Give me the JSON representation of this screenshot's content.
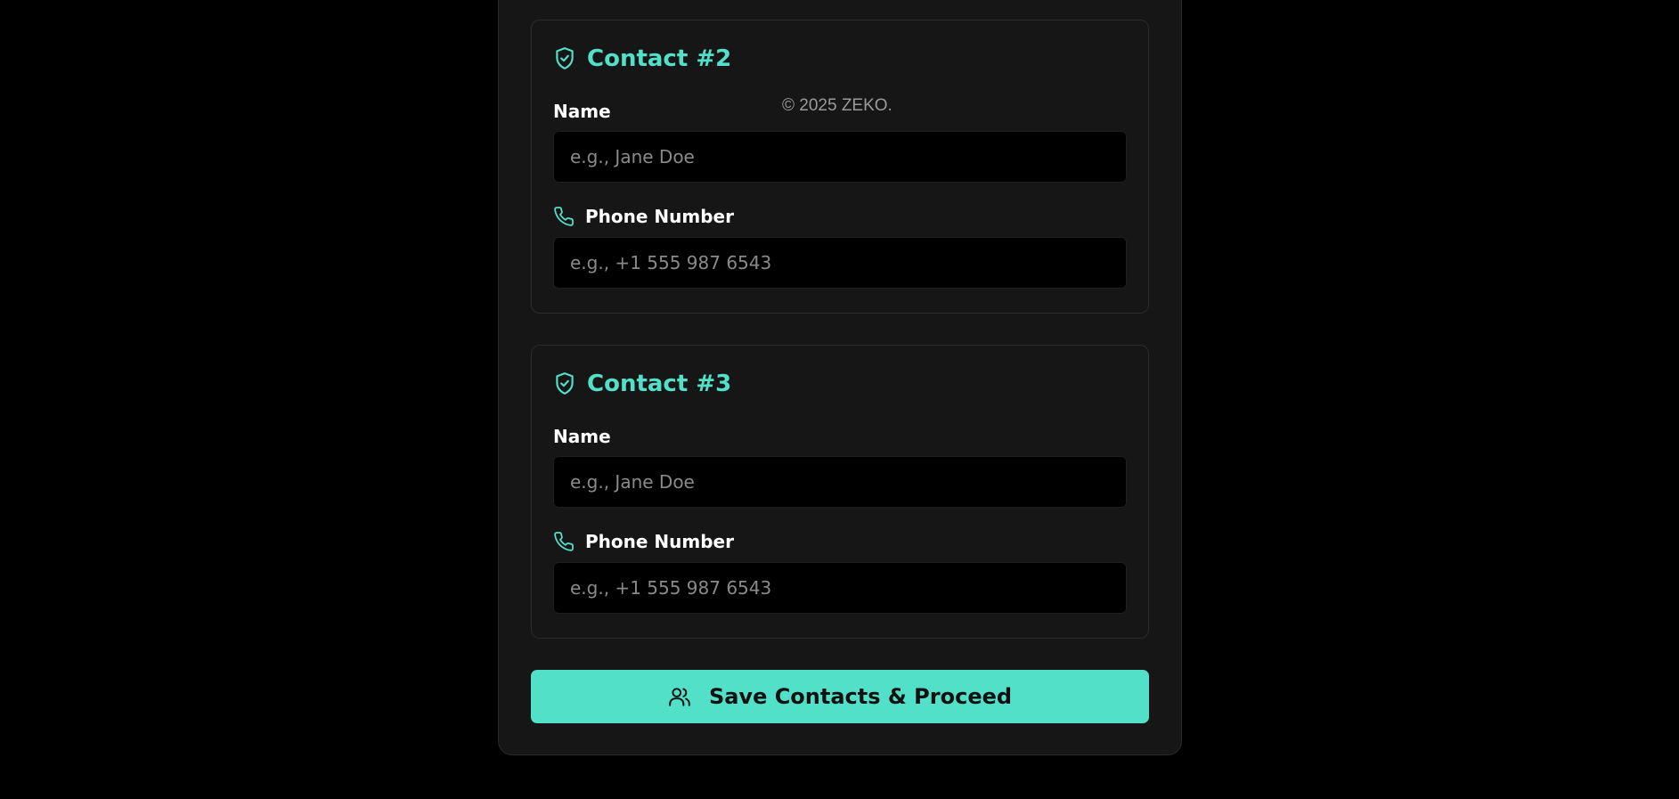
{
  "contacts": [
    {
      "title": "Contact #2",
      "name_label": "Name",
      "name_placeholder": "e.g., Jane Doe",
      "name_value": "",
      "phone_label": "Phone Number",
      "phone_placeholder": "e.g., +1 555 987 6543",
      "phone_value": ""
    },
    {
      "title": "Contact #3",
      "name_label": "Name",
      "name_placeholder": "e.g., Jane Doe",
      "name_value": "",
      "phone_label": "Phone Number",
      "phone_placeholder": "e.g., +1 555 987 6543",
      "phone_value": ""
    }
  ],
  "footer": {
    "copyright": "© 2025 ZEKO."
  },
  "actions": {
    "save_label": "Save Contacts & Proceed"
  },
  "icons": {
    "card_title": "shield-check-icon",
    "phone_label": "phone-icon",
    "save_button": "users-icon"
  },
  "colors": {
    "accent": "#52e0c8",
    "background": "#000000",
    "panel": "#161616",
    "input_background": "#000000",
    "placeholder": "#8a8a8a",
    "footer_text": "#9a9a9a"
  }
}
